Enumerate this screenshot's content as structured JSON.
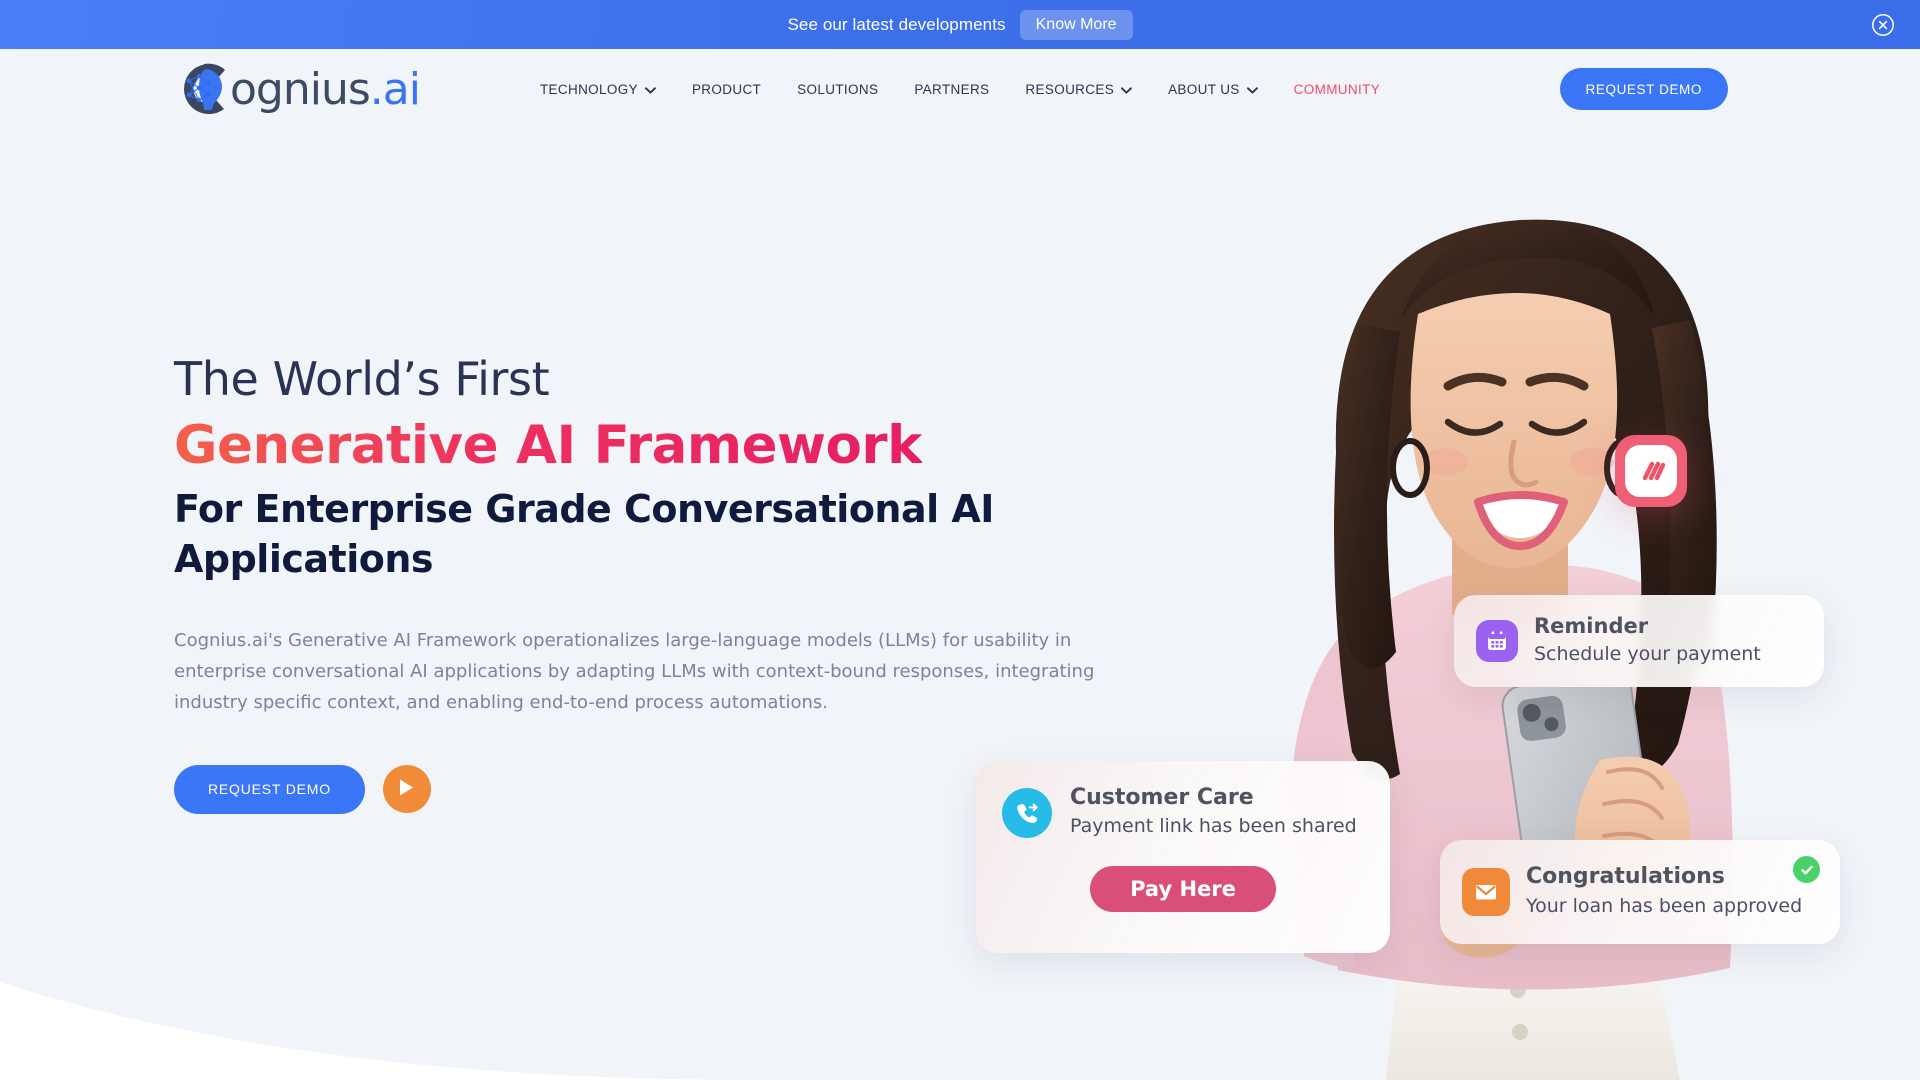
{
  "banner": {
    "message": "See our latest developments",
    "cta_label": "Know More",
    "close_icon": "close-circle-icon",
    "bg_from": "#4b7df6",
    "bg_to": "#3a6de7"
  },
  "header": {
    "logo": {
      "name_dark": "ognius",
      "name_accent": ".ai",
      "mark_icon": "cognius-brain-profile-icon",
      "dark_color": "#3c4a63",
      "accent_color": "#3b74f2"
    },
    "nav": [
      {
        "label": "TECHNOLOGY",
        "has_dropdown": true,
        "accent": false
      },
      {
        "label": "PRODUCT",
        "has_dropdown": false,
        "accent": false
      },
      {
        "label": "SOLUTIONS",
        "has_dropdown": false,
        "accent": false
      },
      {
        "label": "PARTNERS",
        "has_dropdown": false,
        "accent": false
      },
      {
        "label": "RESOURCES",
        "has_dropdown": true,
        "accent": false
      },
      {
        "label": "ABOUT US",
        "has_dropdown": true,
        "accent": false
      },
      {
        "label": "COMMUNITY",
        "has_dropdown": false,
        "accent": true
      }
    ],
    "demo_button": "REQUEST DEMO",
    "accent_color": "#f04a6e",
    "button_color": "#3b76f6"
  },
  "hero": {
    "eyebrow": "The World’s First",
    "headline_gradient": "Generative AI Framework",
    "subheadline": "For Enterprise Grade Conversational AI Applications",
    "paragraph": "Cognius.ai's Generative AI Framework operationalizes large-language models (LLMs) for usability in enterprise conversational AI applications by adapting LLMs with context-bound responses, integrating industry specific context, and enabling end-to-end process automations.",
    "primary_cta": "REQUEST DEMO",
    "play_icon": "play-icon",
    "gradient_from": "#f4604a",
    "gradient_to": "#e61f62",
    "play_color": "#f18b38"
  },
  "cards": {
    "reminder": {
      "title": "Reminder",
      "subtitle": "Schedule your payment",
      "icon": "calendar-icon",
      "icon_color": "#9b62f0"
    },
    "customer_care": {
      "title": "Customer Care",
      "subtitle": "Payment link has been shared",
      "icon": "phone-forward-icon",
      "icon_color": "#27bbe8",
      "button_label": "Pay Here",
      "button_color": "#d94f77"
    },
    "congratulations": {
      "title": "Congratulations",
      "subtitle": "Your loan has been approved",
      "icon": "mail-icon",
      "icon_color": "#f0893a",
      "badge_icon": "check-circle-icon",
      "badge_color": "#4ad268"
    },
    "floating_tile": {
      "icon": "slashes-tile-icon",
      "color": "#ef5f76"
    }
  },
  "page": {
    "background": "#f1f5fa",
    "hero_image_alt": "smiling-woman-with-phone"
  }
}
